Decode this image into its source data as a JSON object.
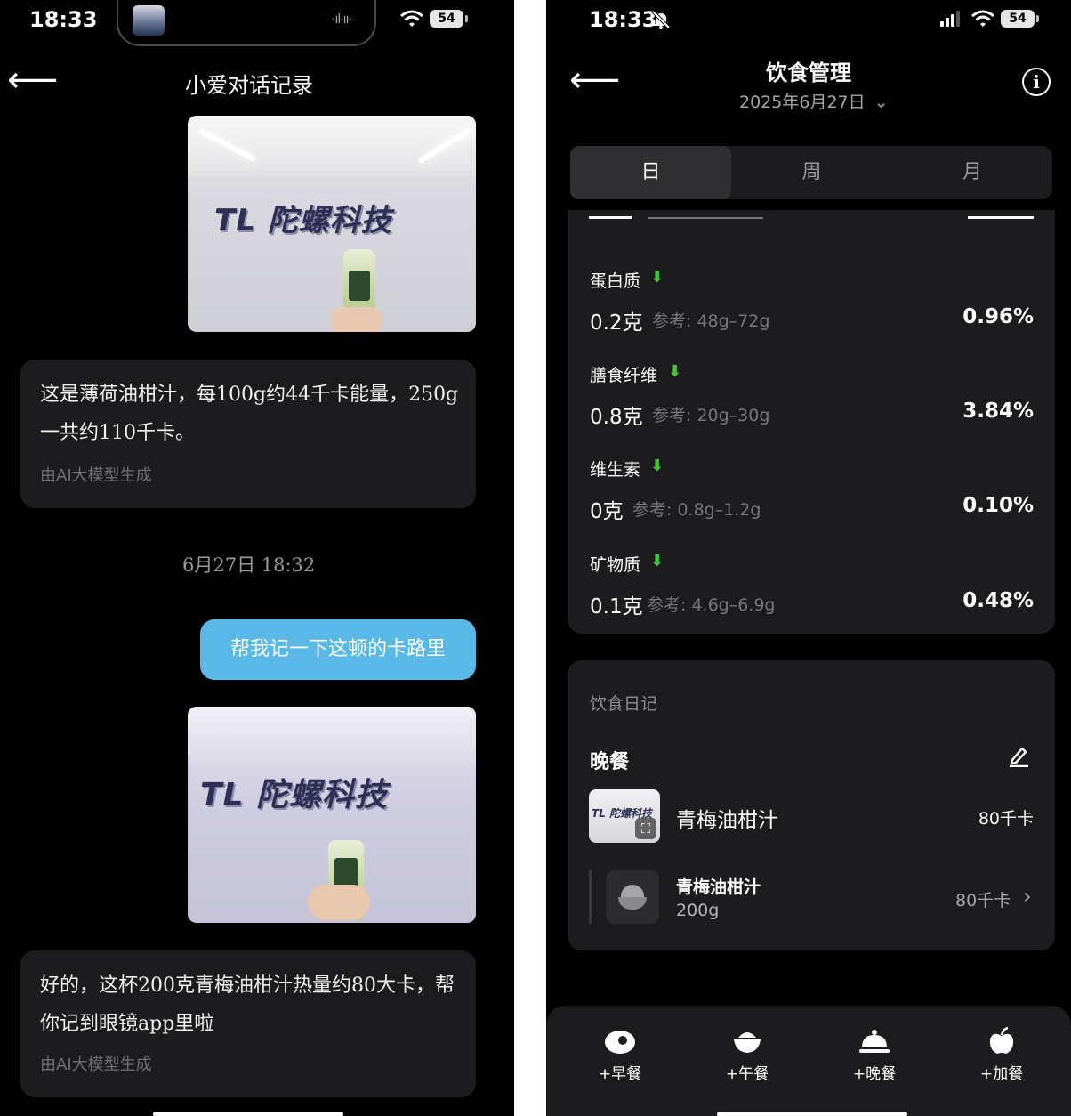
{
  "left": {
    "status": {
      "time": "18:33",
      "battery": "54"
    },
    "header": {
      "title": "小爱对话记录"
    },
    "photo_logo": "TL 陀螺科技",
    "messages": {
      "ai1": "这是薄荷油柑汁，每100g约44千卡能量，250g一共约110千卡。",
      "ai1_note": "由AI大模型生成",
      "timestamp": "6月27日 18:32",
      "user1": "帮我记一下这顿的卡路里",
      "ai2": "好的，这杯200克青梅油柑汁热量约80大卡，帮你记到眼镜app里啦",
      "ai2_note": "由AI大模型生成"
    }
  },
  "right": {
    "status": {
      "time": "18:33",
      "battery": "54"
    },
    "header": {
      "title": "饮食管理",
      "date": "2025年6月27日"
    },
    "tabs": [
      "日",
      "周",
      "月"
    ],
    "nutrients": [
      {
        "name": "蛋白质",
        "amount": "0.2克",
        "ref": "参考: 48g–72g",
        "pct": "0.96%"
      },
      {
        "name": "膳食纤维",
        "amount": "0.8克",
        "ref": "参考: 20g–30g",
        "pct": "3.84%"
      },
      {
        "name": "维生素",
        "amount": "0克",
        "ref": "参考: 0.8g–1.2g",
        "pct": "0.10%"
      },
      {
        "name": "矿物质",
        "amount": "0.1克",
        "ref": "参考: 4.6g–6.9g",
        "pct": "0.48%"
      }
    ],
    "diary": {
      "title": "饮食日记",
      "meal": "晚餐",
      "item_name": "青梅油柑汁",
      "item_kcal": "80千卡",
      "sub_name": "青梅油柑汁",
      "sub_weight": "200g",
      "sub_kcal": "80千卡"
    },
    "bottom": [
      "+早餐",
      "+午餐",
      "+晚餐",
      "+加餐"
    ]
  },
  "colors": {
    "user_bubble": "#59b8e6",
    "down_arrow": "#4bbf3e",
    "card": "#1c1c1e"
  }
}
